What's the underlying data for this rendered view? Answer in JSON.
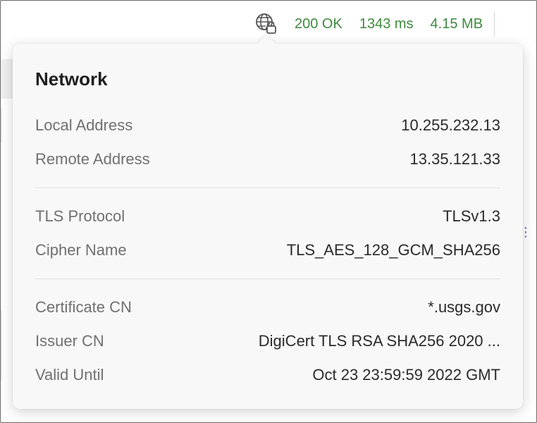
{
  "status": {
    "icon": "globe-lock-icon",
    "code": "200 OK",
    "duration": "1343 ms",
    "size": "4.15 MB",
    "color": "#3d8a3d"
  },
  "popover": {
    "title": "Network",
    "sections": [
      {
        "rows": [
          {
            "label": "Local Address",
            "value": "10.255.232.13"
          },
          {
            "label": "Remote Address",
            "value": "13.35.121.33"
          }
        ]
      },
      {
        "rows": [
          {
            "label": "TLS Protocol",
            "value": "TLSv1.3"
          },
          {
            "label": "Cipher Name",
            "value": "TLS_AES_128_GCM_SHA256"
          }
        ]
      },
      {
        "rows": [
          {
            "label": "Certificate CN",
            "value": "*.usgs.gov"
          },
          {
            "label": "Issuer CN",
            "value": "DigiCert TLS RSA SHA256 2020 ..."
          },
          {
            "label": "Valid Until",
            "value": "Oct 23 23:59:59 2022 GMT"
          }
        ]
      }
    ]
  }
}
